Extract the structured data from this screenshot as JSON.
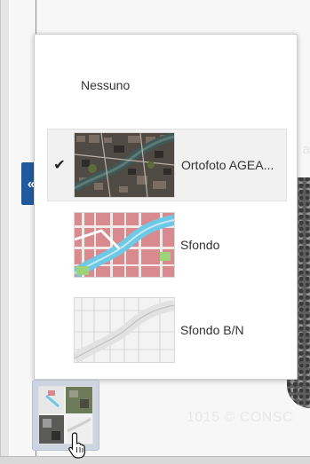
{
  "layers": {
    "none_label": "Nessuno",
    "items": [
      {
        "label": "Ortofoto AGEA...",
        "selected": true,
        "thumb": "orthophoto-thumbnail"
      },
      {
        "label": "Sfondo",
        "selected": false,
        "thumb": "color-basemap-thumbnail"
      },
      {
        "label": "Sfondo B/N",
        "selected": false,
        "thumb": "bw-basemap-thumbnail"
      }
    ]
  },
  "collapse_button": {
    "glyph": "«"
  },
  "check_glyph": "✔",
  "map": {
    "watermark_text": "1015 © CONSC"
  },
  "colors": {
    "accent": "#1f5a9e",
    "selected_bg": "#f1f1f1",
    "river": "#6ec9e6",
    "building": "#d88a8f"
  }
}
